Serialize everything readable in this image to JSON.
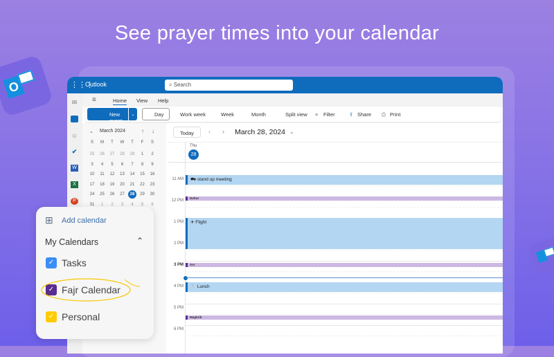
{
  "headline": "See prayer times into your calendar",
  "app": {
    "name": "Outlook",
    "search_placeholder": "Search"
  },
  "nav_tabs": [
    "Home",
    "View",
    "Help"
  ],
  "toolbar": {
    "new_event": "New event",
    "day": "Day",
    "work_week": "Work week",
    "week": "Week",
    "month": "Month",
    "split_view": "Split view",
    "filter": "Filter",
    "share": "Share",
    "print": "Print"
  },
  "mini_calendar": {
    "title": "March 2024",
    "weekdays": [
      "S",
      "M",
      "T",
      "W",
      "T",
      "F",
      "S"
    ],
    "weeks": [
      [
        "25",
        "26",
        "27",
        "28",
        "29",
        "1",
        "2"
      ],
      [
        "3",
        "4",
        "5",
        "6",
        "7",
        "8",
        "9"
      ],
      [
        "10",
        "11",
        "12",
        "13",
        "14",
        "15",
        "16"
      ],
      [
        "17",
        "18",
        "19",
        "20",
        "21",
        "22",
        "23"
      ],
      [
        "24",
        "25",
        "26",
        "27",
        "28",
        "29",
        "30"
      ],
      [
        "31",
        "1",
        "2",
        "3",
        "4",
        "5",
        "6"
      ]
    ],
    "selected": "28"
  },
  "day_view": {
    "today_label": "Today",
    "date_title": "March 28, 2024",
    "day_name": "Thu",
    "day_number": "28",
    "hours": [
      "11 AM",
      "12 PM",
      "1 PM",
      "2 PM",
      "3 PM",
      "4 PM",
      "5 PM",
      "6 PM"
    ],
    "events": [
      {
        "title": "stand up meeting",
        "start": 11,
        "end": 11.5,
        "type": "event"
      },
      {
        "title": "Duhur",
        "start": 12,
        "end": 12.2,
        "type": "prayer"
      },
      {
        "title": "Flight",
        "start": 13,
        "end": 14.5,
        "type": "event"
      },
      {
        "title": "Asr",
        "start": 15.1,
        "end": 15.3,
        "type": "prayer"
      },
      {
        "title": "Lunch",
        "start": 16,
        "end": 16.5,
        "type": "event"
      },
      {
        "title": "Maghrib",
        "start": 17.55,
        "end": 17.75,
        "type": "prayer"
      }
    ],
    "now": 15.8
  },
  "calendars_card": {
    "add_calendar": "Add calendar",
    "section_title": "My Calendars",
    "items": [
      {
        "label": "Tasks",
        "color": "#3a8ef6"
      },
      {
        "label": "Fajr Calendar",
        "color": "#5a2d91"
      },
      {
        "label": "Personal",
        "color": "#ffcc00"
      }
    ]
  }
}
